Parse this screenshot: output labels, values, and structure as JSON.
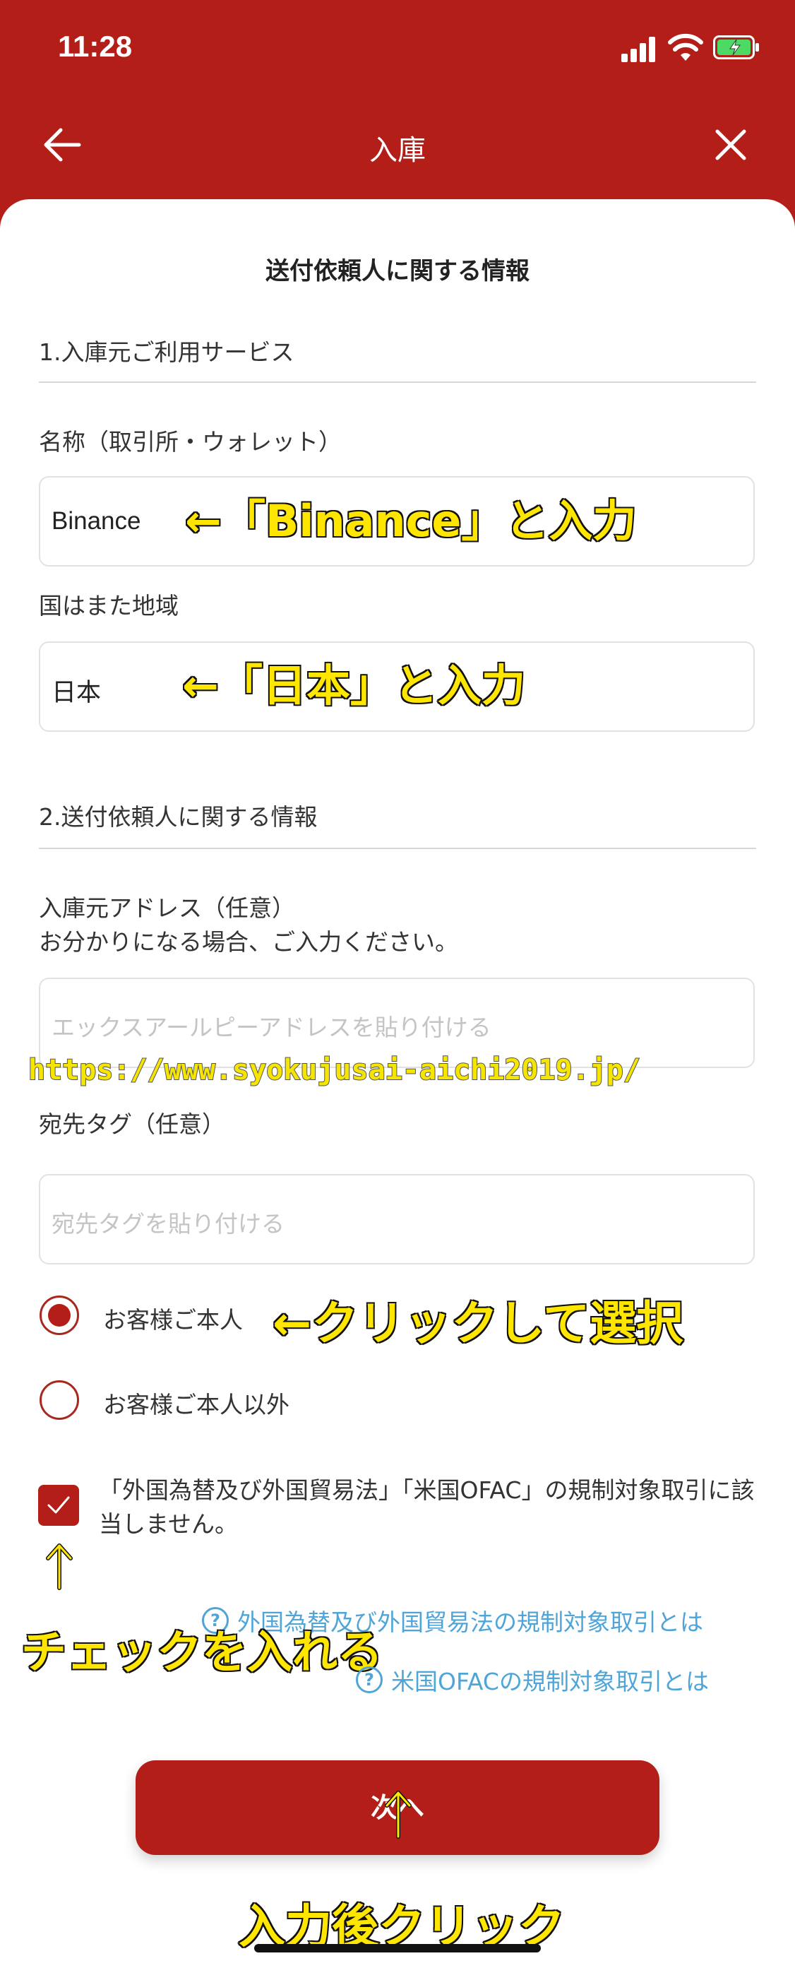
{
  "status_bar": {
    "time": "11:28"
  },
  "nav": {
    "title": "入庫"
  },
  "form": {
    "section_title": "送付依頼人に関する情報",
    "section1_heading": "1.入庫元ご利用サービス",
    "name_label": "名称（取引所・ウォレット）",
    "name_value": "Binance",
    "country_label": "国はまた地域",
    "country_value": "日本",
    "section2_heading": "2.送付依頼人に関する情報",
    "address_label_line1": "入庫元アドレス（任意）",
    "address_label_line2": "お分かりになる場合、ご入力ください。",
    "address_placeholder": "エックスアールピーアドレスを貼り付ける",
    "tag_label": "宛先タグ（任意）",
    "tag_placeholder": "宛先タグを貼り付ける",
    "radio_self": "お客様ご本人",
    "radio_other": "お客様ご本人以外",
    "consent_text": "「外国為替及び外国貿易法」「米国OFAC」の規制対象取引に該当しません。",
    "link_fx": "外国為替及び外国貿易法の規制対象取引とは",
    "link_ofac": "米国OFACの規制対象取引とは",
    "next_button": "次へ"
  },
  "annotations": {
    "binance": "←「Binance」と入力",
    "japan": "←「日本」と入力",
    "click_select": "←クリックして選択",
    "check": "チェックを入れる",
    "after_input": "入力後クリック",
    "watermark": "https://www.syokujusai-aichi2019.jp/"
  },
  "colors": {
    "brand_red": "#b31f18",
    "link_blue": "#4fa5d8",
    "annotation_yellow": "#ffe600"
  }
}
